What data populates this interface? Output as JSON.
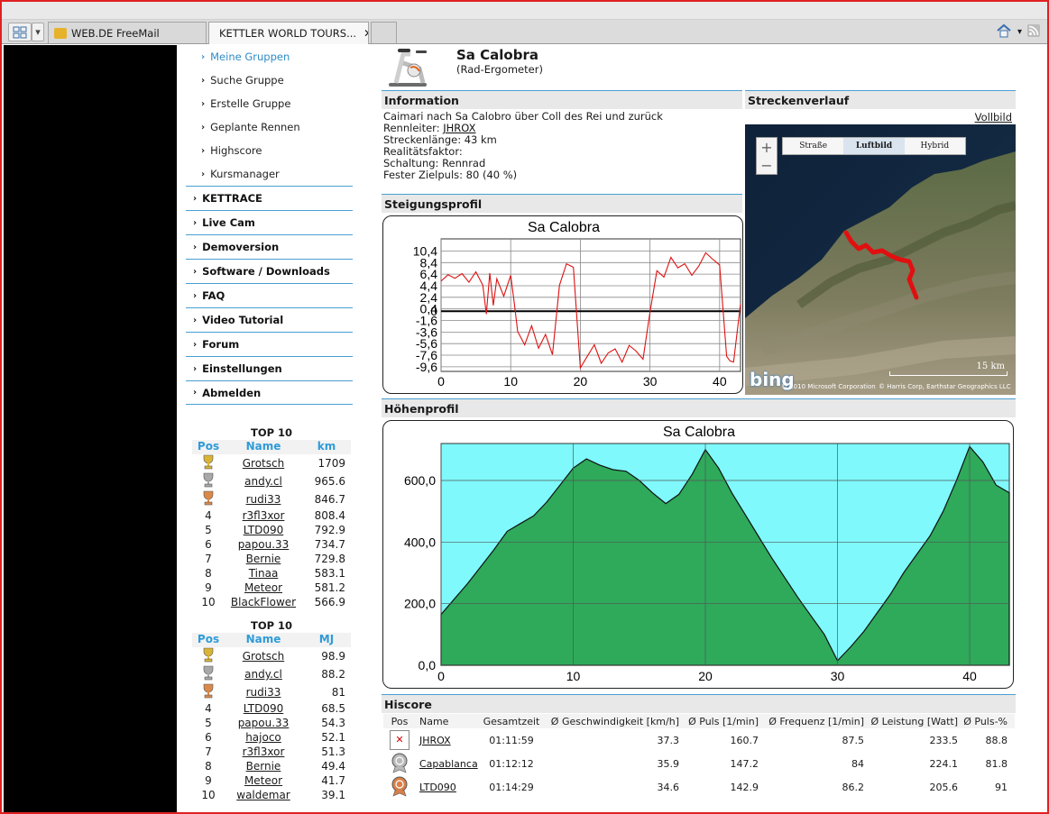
{
  "browser": {
    "tabs": [
      {
        "label": "WEB.DE FreeMail",
        "active": false
      },
      {
        "label": "KETTLER WORLD TOURS...",
        "active": true
      }
    ]
  },
  "nav": {
    "sub_items": [
      "Meine Gruppen",
      "Suche Gruppe",
      "Erstelle Gruppe",
      "Geplante Rennen",
      "Highscore",
      "Kursmanager"
    ],
    "main_items": [
      "KETTRACE",
      "Live Cam",
      "Demoversion",
      "Software / Downloads",
      "FAQ",
      "Video Tutorial",
      "Forum",
      "Einstellungen",
      "Abmelden"
    ]
  },
  "top10_km": {
    "title": "TOP 10",
    "headers": {
      "pos": "Pos",
      "name": "Name",
      "value": "km"
    },
    "rows": [
      {
        "pos": "",
        "medal": "gold",
        "name": "Grotsch",
        "value": "1709"
      },
      {
        "pos": "",
        "medal": "silver",
        "name": "andy.cl",
        "value": "965.6"
      },
      {
        "pos": "",
        "medal": "bronze",
        "name": "rudi33",
        "value": "846.7"
      },
      {
        "pos": "4",
        "name": "r3fl3xor",
        "value": "808.4"
      },
      {
        "pos": "5",
        "name": "LTD090",
        "value": "792.9"
      },
      {
        "pos": "6",
        "name": "papou.33",
        "value": "734.7"
      },
      {
        "pos": "7",
        "name": "Bernie",
        "value": "729.8"
      },
      {
        "pos": "8",
        "name": "Tinaa",
        "value": "583.1"
      },
      {
        "pos": "9",
        "name": "Meteor",
        "value": "581.2"
      },
      {
        "pos": "10",
        "name": "BlackFlower",
        "value": "566.9"
      }
    ]
  },
  "top10_mj": {
    "title": "TOP 10",
    "headers": {
      "pos": "Pos",
      "name": "Name",
      "value": "MJ"
    },
    "rows": [
      {
        "pos": "",
        "medal": "gold",
        "name": "Grotsch",
        "value": "98.9"
      },
      {
        "pos": "",
        "medal": "silver",
        "name": "andy.cl",
        "value": "88.2"
      },
      {
        "pos": "",
        "medal": "bronze",
        "name": "rudi33",
        "value": "81"
      },
      {
        "pos": "4",
        "name": "LTD090",
        "value": "68.5"
      },
      {
        "pos": "5",
        "name": "papou.33",
        "value": "54.3"
      },
      {
        "pos": "6",
        "name": "hajoco",
        "value": "52.1"
      },
      {
        "pos": "7",
        "name": "r3fl3xor",
        "value": "51.3"
      },
      {
        "pos": "8",
        "name": "Bernie",
        "value": "49.4"
      },
      {
        "pos": "9",
        "name": "Meteor",
        "value": "41.7"
      },
      {
        "pos": "10",
        "name": "waldemar",
        "value": "39.1"
      }
    ]
  },
  "page": {
    "title": "Sa Calobra",
    "subtitle": "(Rad-Ergometer)"
  },
  "information": {
    "heading": "Information",
    "description": "Caimari nach Sa Calobro über Coll des Rei und zurück",
    "rennleiter_label": "Rennleiter:",
    "rennleiter": "JHROX",
    "strecke": "Streckenlänge: 43 km",
    "realitaet": "Realitätsfaktor:",
    "schaltung": "Schaltung: Rennrad",
    "zielpuls": "Fester Zielpuls: 80 (40 %)"
  },
  "streckenverlauf": {
    "heading": "Streckenverlauf",
    "vollbild": "Vollbild",
    "map_buttons": [
      "Straße",
      "Luftbild",
      "Hybrid"
    ],
    "scale": "15 km",
    "logo": "bing",
    "copyright1": "© 2010 Microsoft Corporation",
    "copyright2": "© Harris Corp, Earthstar Geographics LLC"
  },
  "steigung": {
    "heading": "Steigungsprofil"
  },
  "hoehe": {
    "heading": "Höhenprofil"
  },
  "chart_data": [
    {
      "type": "line",
      "title": "Sa Calobra",
      "xlim": [
        0,
        43
      ],
      "ylim": [
        -10.4,
        12.5
      ],
      "x_ticks": [
        "0",
        "10",
        "20",
        "30",
        "40"
      ],
      "y_ticks": [
        "10,4",
        "8,4",
        "6,4",
        "4,4",
        "2,4",
        "0,4",
        "0",
        "-1,6",
        "-3,6",
        "-5,6",
        "-7,6",
        "-9,6"
      ],
      "series": [
        {
          "x": [
            0,
            1,
            2,
            3,
            4,
            5,
            6,
            6.5,
            7,
            7.5,
            8,
            9,
            10,
            10.5,
            11,
            12,
            13,
            14,
            15,
            16,
            17,
            18,
            19,
            20,
            21,
            22,
            23,
            24,
            25,
            26,
            27,
            28,
            29,
            30,
            31,
            32,
            33,
            34,
            35,
            36,
            37,
            38,
            39,
            40,
            41,
            41.5,
            42,
            43
          ],
          "y": [
            5.2,
            6.3,
            5.7,
            6.5,
            5.0,
            6.8,
            4.5,
            -0.5,
            6.6,
            1.0,
            5.6,
            2.6,
            6.2,
            1.5,
            -3.5,
            -5.8,
            -2.5,
            -6.4,
            -4.0,
            -7.5,
            4.5,
            8.2,
            7.6,
            -9.8,
            -7.8,
            -5.8,
            -9.0,
            -7.2,
            -6.5,
            -8.8,
            -5.9,
            -6.9,
            -8.3,
            -0.2,
            7.0,
            5.9,
            9.3,
            7.5,
            8.2,
            6.2,
            7.8,
            10.1,
            9.0,
            8.0,
            -7.8,
            -8.6,
            -8.8,
            1.3
          ]
        }
      ]
    },
    {
      "type": "area",
      "title": "Sa Calobra",
      "xlim": [
        0,
        43
      ],
      "ylim": [
        0,
        720
      ],
      "x_ticks": [
        "0",
        "10",
        "20",
        "30",
        "40"
      ],
      "y_ticks": [
        "0,0",
        "200,0",
        "400,0",
        "600,0"
      ],
      "series": [
        {
          "x": [
            0,
            2,
            4,
            5,
            6,
            7,
            8,
            9,
            10,
            11,
            12,
            13,
            14,
            15,
            16,
            17,
            18,
            19,
            20,
            21,
            22,
            23,
            24,
            25,
            26,
            27,
            28,
            29,
            30,
            31,
            32,
            33,
            34,
            35,
            36,
            37,
            38,
            39,
            40,
            41,
            42,
            43
          ],
          "y": [
            165,
            265,
            375,
            435,
            460,
            485,
            530,
            585,
            640,
            670,
            650,
            635,
            630,
            600,
            560,
            525,
            555,
            620,
            700,
            640,
            560,
            490,
            420,
            350,
            285,
            220,
            160,
            100,
            15,
            60,
            110,
            170,
            230,
            300,
            360,
            420,
            500,
            600,
            710,
            660,
            585,
            560
          ]
        }
      ]
    }
  ],
  "hiscore": {
    "heading": "Hiscore",
    "headers": [
      "Pos",
      "Name",
      "Gesamtzeit",
      "Ø Geschwindigkeit [km/h]",
      "Ø Puls [1/min]",
      "Ø Frequenz [1/min]",
      "Ø Leistung [Watt]",
      "Ø Puls-%"
    ],
    "rows": [
      {
        "medal": "broken",
        "name": "JHROX",
        "time": "01:11:59",
        "speed": "37.3",
        "puls": "160.7",
        "freq": "87.5",
        "watt": "233.5",
        "pp": "88.8"
      },
      {
        "medal": "silver",
        "name": "Capablanca",
        "time": "01:12:12",
        "speed": "35.9",
        "puls": "147.2",
        "freq": "84",
        "watt": "224.1",
        "pp": "81.8"
      },
      {
        "medal": "bronze",
        "name": "LTD090",
        "time": "01:14:29",
        "speed": "34.6",
        "puls": "142.9",
        "freq": "86.2",
        "watt": "205.6",
        "pp": "91"
      }
    ]
  },
  "colors": {
    "accent": "#2f9bd8",
    "slope_line": "#dd1111",
    "elevation_fill": "#2eaa5a",
    "elevation_bg": "#7ff9fb"
  }
}
